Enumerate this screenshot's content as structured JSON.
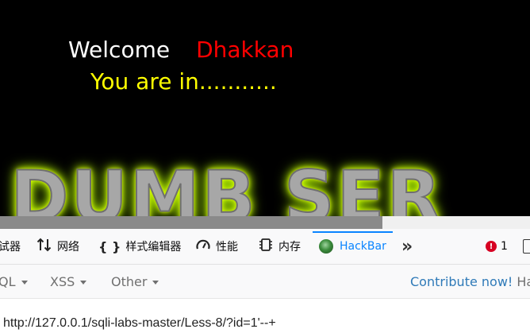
{
  "page": {
    "welcome_word": "Welcome",
    "user_name": "Dhakkan",
    "status_text": "You are in...........",
    "banner_text": "I DUMB SER"
  },
  "devtools": {
    "tabs": [
      {
        "label": "试器",
        "icon": "debugger-icon"
      },
      {
        "label": "网络",
        "icon": "network-arrows-icon"
      },
      {
        "label": "样式编辑器",
        "icon": "braces-icon"
      },
      {
        "label": "性能",
        "icon": "gauge-icon"
      },
      {
        "label": "内存",
        "icon": "memory-chip-icon"
      },
      {
        "label": "HackBar",
        "icon": "hackbar-icon",
        "active": true
      }
    ],
    "overflow_icon": "double-chevron-icon",
    "error_count": "1"
  },
  "hackbar": {
    "menus": [
      {
        "label": "QL"
      },
      {
        "label": "XSS"
      },
      {
        "label": "Other"
      }
    ],
    "contribute_label": "Contribute now!",
    "contribute_tail": "Ha",
    "url_value": "http://127.0.0.1/sqli-labs-master/Less-8/?id=1'--+"
  },
  "colors": {
    "welcome": "#ffffff",
    "user_name": "#ff0000",
    "status": "#ffff00",
    "active_tab": "#0a84ff",
    "contribute": "#2f7ab8"
  }
}
